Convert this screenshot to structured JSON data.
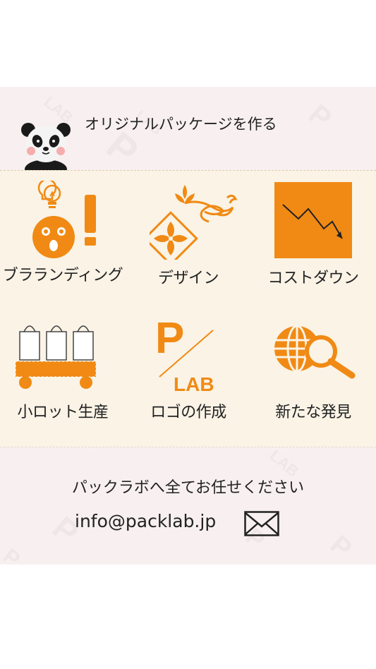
{
  "header": {
    "title": "オリジナルパッケージを作る",
    "mascot_icon": "panda-icon"
  },
  "features": [
    {
      "label": "ブラランディング",
      "icon": "lightbulb-face-exclaim-icon"
    },
    {
      "label": "デザイン",
      "icon": "floral-ornament-icon"
    },
    {
      "label": "コストダウン",
      "icon": "cost-down-chart-icon"
    },
    {
      "label": "小ロット生産",
      "icon": "shopping-bags-cart-icon"
    },
    {
      "label": "ロゴの作成",
      "icon": "plab-logo-icon"
    },
    {
      "label": "新たな発見",
      "icon": "globe-search-icon"
    }
  ],
  "footer": {
    "cta": "パックラボへ全てお任せください",
    "email": "info@packlab.jp",
    "mail_icon": "envelope-icon"
  },
  "colors": {
    "accent": "#f08a14",
    "pink_band": "#f8f0f0",
    "cream_band": "#faf3e6"
  }
}
